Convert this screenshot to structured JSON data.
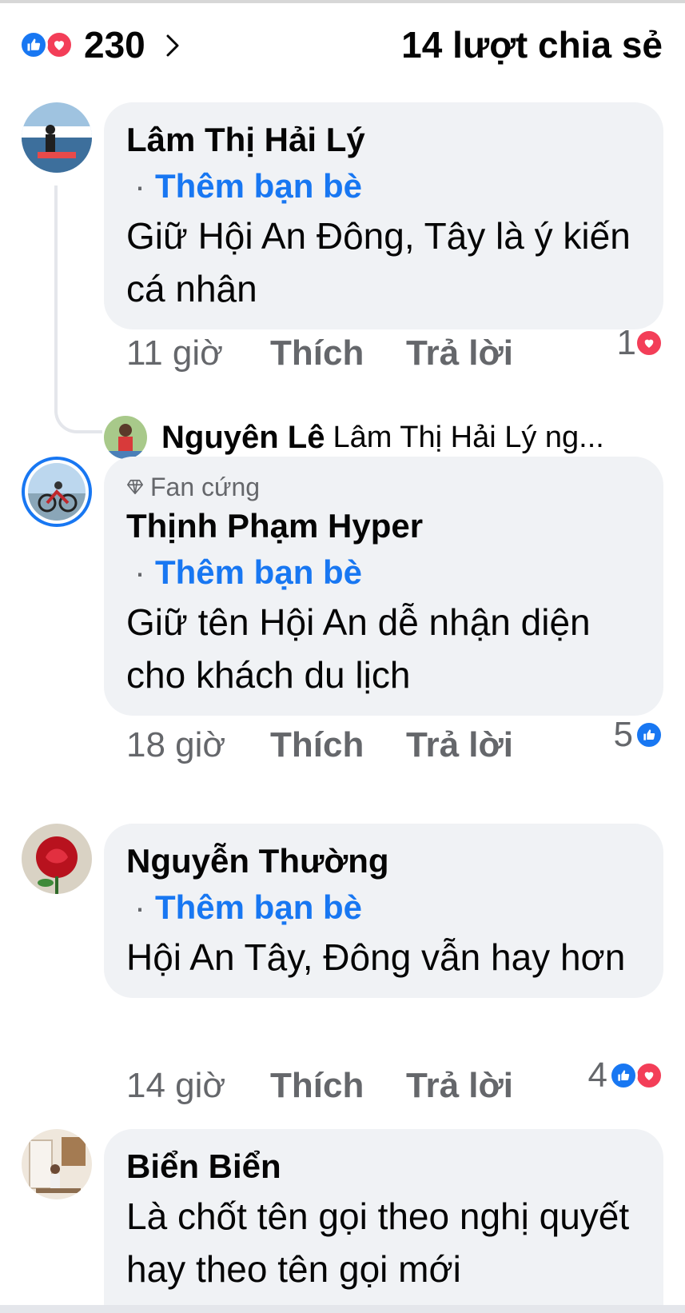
{
  "reactions": {
    "count": "230",
    "icons": [
      "like-icon",
      "love-icon"
    ],
    "shares": "14 lượt chia sẻ"
  },
  "colors": {
    "accent": "#1877f2",
    "love": "#f33e58",
    "bubble": "#f0f2f5",
    "secondary_text": "#65676b"
  },
  "comments": [
    {
      "author": "Lâm Thị Hải Lý",
      "add_friend": "Thêm bạn bè",
      "text": "Giữ Hội An Đông, Tây là ý kiến cá nhân",
      "time": "11 giờ",
      "like": "Thích",
      "reply": "Trả lời",
      "reaction_count": "1",
      "reaction_icons": [
        "love-icon"
      ],
      "reply_preview": {
        "author": "Nguyên Lê",
        "text": "Lâm Thị Hải Lý ng..."
      }
    },
    {
      "badge": "Fan cứng",
      "author": "Thịnh Phạm Hyper",
      "add_friend": "Thêm bạn bè",
      "text": "Giữ tên Hội An dễ nhận diện cho khách du lịch",
      "time": "18 giờ",
      "like": "Thích",
      "reply": "Trả lời",
      "reaction_count": "5",
      "reaction_icons": [
        "like-icon"
      ]
    },
    {
      "author": "Nguyễn Thường",
      "add_friend": "Thêm bạn bè",
      "text": "Hội An Tây, Đông vẫn hay hơn",
      "time": "14 giờ",
      "like": "Thích",
      "reply": "Trả lời",
      "reaction_count": "4",
      "reaction_icons": [
        "like-icon",
        "love-icon"
      ]
    },
    {
      "author": "Biển Biển",
      "text": "Là chốt tên gọi theo nghị quyết hay theo tên gọi mới"
    }
  ]
}
